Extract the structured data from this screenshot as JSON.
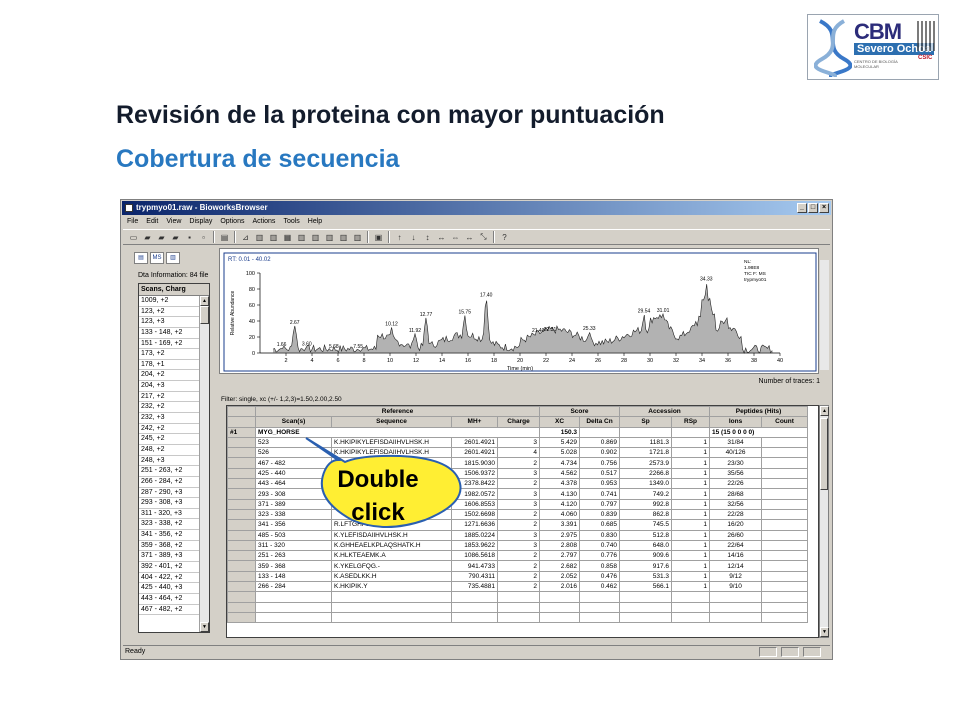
{
  "slide": {
    "title": "Revisión de la proteina con mayor puntuación",
    "subtitle": "Cobertura de secuencia",
    "logo": {
      "name": "CBM",
      "sub": "Severo Ochoa",
      "tag": "CENTRO DE BIOLOGÍA MOLECULAR",
      "csic": "CSIC"
    },
    "callout": {
      "line1": "Double",
      "line2": "click"
    },
    "accent_color": "#2878c0"
  },
  "window": {
    "title": "trypmyo01.raw - BioworksBrowser",
    "controls": [
      "_",
      "□",
      "×"
    ],
    "menu": [
      "File",
      "Edit",
      "View",
      "Display",
      "Options",
      "Actions",
      "Tools",
      "Help"
    ],
    "status": "Ready"
  },
  "left_panel": {
    "dta_info": "Dta Information: 84 file",
    "scan_header": "Scans, Charg",
    "scans": [
      "1009, +2",
      "123, +2",
      "123, +3",
      "133 - 148, +2",
      "151 - 169, +2",
      "173, +2",
      "178, +1",
      "204, +2",
      "204, +3",
      "217, +2",
      "232, +2",
      "232, +3",
      "242, +2",
      "245, +2",
      "248, +2",
      "248, +3",
      "251 - 263, +2",
      "266 - 284, +2",
      "287 - 290, +3",
      "293 - 308, +3",
      "311 - 320, +3",
      "323 - 338, +2",
      "341 - 356, +2",
      "359 - 368, +2",
      "371 - 389, +3",
      "392 - 401, +2",
      "404 - 422, +2",
      "425 - 440, +3",
      "443 - 464, +2",
      "467 - 482, +2"
    ]
  },
  "chromatogram": {
    "rt_label": "RT: 0.01 - 40.02",
    "ylabel": "Relative Abundance",
    "xlabel": "Time (min)",
    "legend": [
      "NL:",
      "1.98E8",
      "TIC F: MS",
      "trypmyo01"
    ],
    "y_ticks": [
      100,
      80,
      60,
      40,
      20,
      0
    ],
    "x_ticks": [
      2,
      4,
      6,
      8,
      10,
      12,
      14,
      16,
      18,
      20,
      22,
      24,
      26,
      28,
      30,
      32,
      34,
      36,
      38,
      40
    ],
    "peak_labels": [
      {
        "rt": 1.66,
        "label": "1.66",
        "h": 6
      },
      {
        "rt": 2.67,
        "label": "2.67",
        "h": 34
      },
      {
        "rt": 3.6,
        "label": "3.60",
        "h": 7
      },
      {
        "rt": 5.68,
        "label": "5.68",
        "h": 4
      },
      {
        "rt": 7.55,
        "label": "7.55",
        "h": 4
      },
      {
        "rt": 10.12,
        "label": "10.12",
        "h": 32
      },
      {
        "rt": 11.92,
        "label": "11.92",
        "h": 24
      },
      {
        "rt": 12.77,
        "label": "12.77",
        "h": 44
      },
      {
        "rt": 15.75,
        "label": "15.75",
        "h": 47
      },
      {
        "rt": 17.4,
        "label": "17.40",
        "h": 68
      },
      {
        "rt": 21.4,
        "label": "21.40",
        "h": 24
      },
      {
        "rt": 22.31,
        "label": "22.31",
        "h": 25
      },
      {
        "rt": 25.33,
        "label": "25.33",
        "h": 26
      },
      {
        "rt": 29.54,
        "label": "29.54",
        "h": 48
      },
      {
        "rt": 31.01,
        "label": "31.01",
        "h": 49
      },
      {
        "rt": 34.33,
        "label": "34.33",
        "h": 88
      }
    ],
    "ntraces": "Number of traces: 1"
  },
  "filter": "Filter: single, xc (+/- 1,2,3)=1.50,2.00,2.50",
  "table": {
    "groups": [
      "Reference",
      "Score",
      "Accession",
      "Peptides (Hits)"
    ],
    "columns": [
      "Scan(s)",
      "Sequence",
      "MH+",
      "Charge",
      "XC",
      "Delta Cn",
      "Sp",
      "RSp",
      "Ions",
      "Count"
    ],
    "hit": {
      "rank": "#1",
      "name": "MYG_HORSE",
      "score": "150.3",
      "peptides": "15 (15 0 0 0 0)"
    },
    "rows": [
      [
        "523",
        "K.HKIPIKYLEFISDAIIHVLHSK.H",
        "2601.4921",
        "3",
        "5.429",
        "0.869",
        "1181.3",
        "1",
        "31/84"
      ],
      [
        "526",
        "K.HKIPIKYLEFISDAIIHVLHSK.H",
        "2601.4921",
        "4",
        "5.028",
        "0.902",
        "1721.8",
        "1",
        "40/126"
      ],
      [
        "467 - 482",
        "",
        "1815.9030",
        "2",
        "4.734",
        "0.756",
        "2573.9",
        "1",
        "23/30"
      ],
      [
        "425 - 440",
        "",
        "1506.9372",
        "3",
        "4.562",
        "0.517",
        "2266.8",
        "1",
        "35/56"
      ],
      [
        "443 - 464",
        "",
        "2378.8422",
        "2",
        "4.378",
        "0.953",
        "1349.0",
        "1",
        "22/26"
      ],
      [
        "293 - 308",
        "",
        "1982.0572",
        "3",
        "4.130",
        "0.741",
        "749.2",
        "1",
        "28/68"
      ],
      [
        "371 - 389",
        "",
        "1606.8553",
        "3",
        "4.120",
        "0.797",
        "992.8",
        "1",
        "32/56"
      ],
      [
        "323 - 338",
        "",
        "1502.6698",
        "2",
        "4.060",
        "0.839",
        "862.8",
        "1",
        "22/28"
      ],
      [
        "341 - 356",
        "R.LFTGHPETLEK.F",
        "1271.6636",
        "2",
        "3.391",
        "0.685",
        "745.5",
        "1",
        "16/20"
      ],
      [
        "485 - 503",
        "K.YLEFISDAIIHVLHSK.H",
        "1885.0224",
        "3",
        "2.975",
        "0.830",
        "512.8",
        "1",
        "26/60"
      ],
      [
        "311 - 320",
        "K.GHHEAELKPLAQSHATK.H",
        "1853.9622",
        "3",
        "2.808",
        "0.740",
        "648.0",
        "1",
        "22/64"
      ],
      [
        "251 - 263",
        "K.HLKTEAEMK.A",
        "1086.5618",
        "2",
        "2.797",
        "0.776",
        "909.6",
        "1",
        "14/16"
      ],
      [
        "359 - 368",
        "K.YKELGFQG.-",
        "941.4733",
        "2",
        "2.682",
        "0.858",
        "917.6",
        "1",
        "12/14"
      ],
      [
        "133 - 148",
        "K.ASEDLKK.H",
        "790.4311",
        "2",
        "2.052",
        "0.476",
        "531.3",
        "1",
        "9/12"
      ],
      [
        "266 - 284",
        "K.HKIPIK.Y",
        "735.4881",
        "2",
        "2.016",
        "0.462",
        "566.1",
        "1",
        "9/10"
      ]
    ]
  }
}
